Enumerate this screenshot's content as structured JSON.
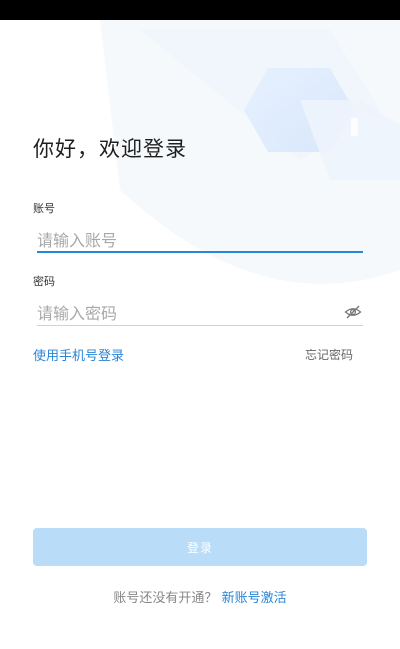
{
  "header": {
    "title": "你好，欢迎登录"
  },
  "account": {
    "label": "账号",
    "placeholder": "请输入账号"
  },
  "password": {
    "label": "密码",
    "placeholder": "请输入密码"
  },
  "links": {
    "phone_login": "使用手机号登录",
    "forgot_password": "忘记密码"
  },
  "login_button": {
    "label": "登录"
  },
  "footer": {
    "question": "账号还没有开通？",
    "activate": "新账号激活"
  },
  "colors": {
    "accent": "#2a86d6",
    "button_disabled": "#b9dcf8",
    "active_underline": "#2a86d6",
    "status_bar": "#000000"
  }
}
